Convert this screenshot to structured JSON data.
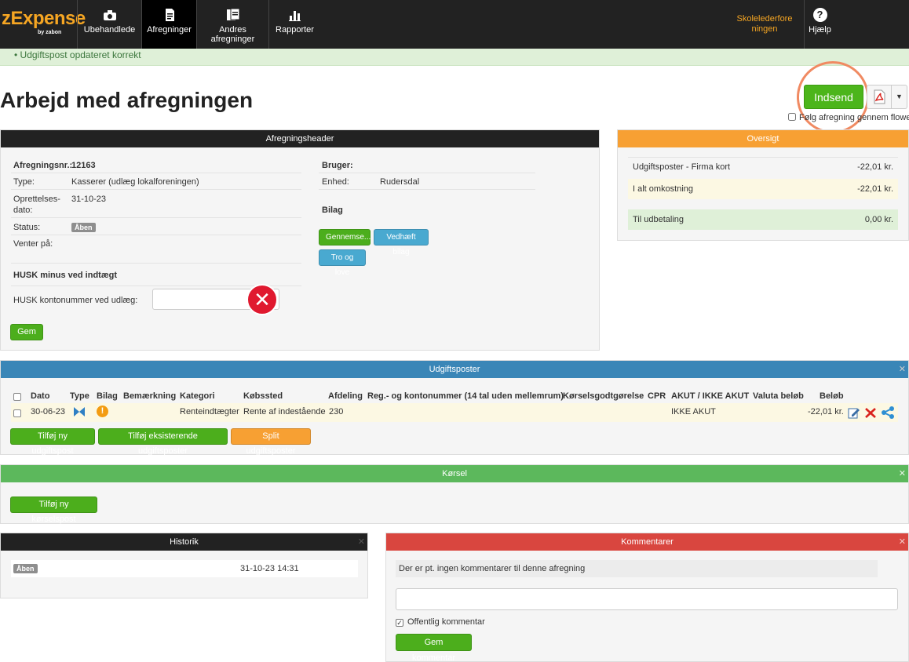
{
  "app": {
    "brand": "zExpense",
    "byline": "by zabon"
  },
  "nav": {
    "items": [
      {
        "label": "Ubehandlede"
      },
      {
        "label": "Afregninger"
      },
      {
        "label": "Andres afregninger"
      },
      {
        "label": "Rapporter"
      }
    ],
    "org": "Skolelederforeningen",
    "help": "Hjælp"
  },
  "flash": "Udgiftspost opdateret korrekt",
  "page_title": "Arbejd med afregningen",
  "actions": {
    "submit": "Indsend",
    "flow_label": "Følg afregning gennem flowet"
  },
  "header_panel": {
    "title": "Afregningsheader",
    "number_label": "Afregningsnr.:",
    "number": "12163",
    "type_label": "Type:",
    "type": "Kasserer (udlæg lokalforeningen)",
    "created_label_1": "Oprettelses-",
    "created_label_2": "dato:",
    "created": "31-10-23",
    "status_label": "Status:",
    "status": "Åben",
    "waiting_label": "Venter på:",
    "reminder": "HUSK minus ved indtægt",
    "account_label": "HUSK kontonummer ved udlæg:",
    "save": "Gem",
    "user_label": "Bruger:",
    "unit_label": "Enhed:",
    "unit": "Rudersdal",
    "attachments_label": "Bilag",
    "browse": "Gennemse...",
    "attach": "Vedhæft bilag",
    "oath": "Tro og love"
  },
  "overview": {
    "title": "Oversigt",
    "rows": [
      {
        "label": "Udgiftsposter - Firma kort",
        "value": "-22,01 kr."
      },
      {
        "label": "I alt omkostning",
        "value": "-22,01 kr."
      },
      {
        "label": "Til udbetaling",
        "value": "0,00 kr."
      }
    ]
  },
  "expenses": {
    "title": "Udgiftsposter",
    "columns": [
      "Dato",
      "Type",
      "Bilag",
      "Bemærkning",
      "Kategori",
      "Købssted",
      "Afdeling",
      "Reg.- og kontonummer (14 tal uden mellemrum)",
      "Kørselsgodtgørelse",
      "CPR",
      "AKUT / IKKE AKUT",
      "Valuta beløb",
      "Beløb"
    ],
    "rows": [
      {
        "date": "30-06-23",
        "category": "Renteindtægter",
        "store": "Rente af indestående",
        "department": "230",
        "urgency": "IKKE AKUT",
        "amount": "-22,01 kr."
      }
    ],
    "add_new": "Tilføj ny udgiftspost",
    "add_existing": "Tilføj eksisterende udgiftsposter",
    "split": "Split udgiftsposter"
  },
  "driving": {
    "title": "Kørsel",
    "add": "Tilføj ny kørselspost"
  },
  "history": {
    "title": "Historik",
    "status": "Åben",
    "timestamp": "31-10-23 14:31"
  },
  "comments": {
    "title": "Kommentarer",
    "empty": "Der er pt. ingen kommentarer til denne afregning",
    "public_label": "Offentlig kommentar",
    "save": "Gem kommentar"
  },
  "colors": {
    "accent": "#f6a623",
    "green": "#4cae1c",
    "blue": "#3a86b7",
    "red": "#d9463f"
  }
}
